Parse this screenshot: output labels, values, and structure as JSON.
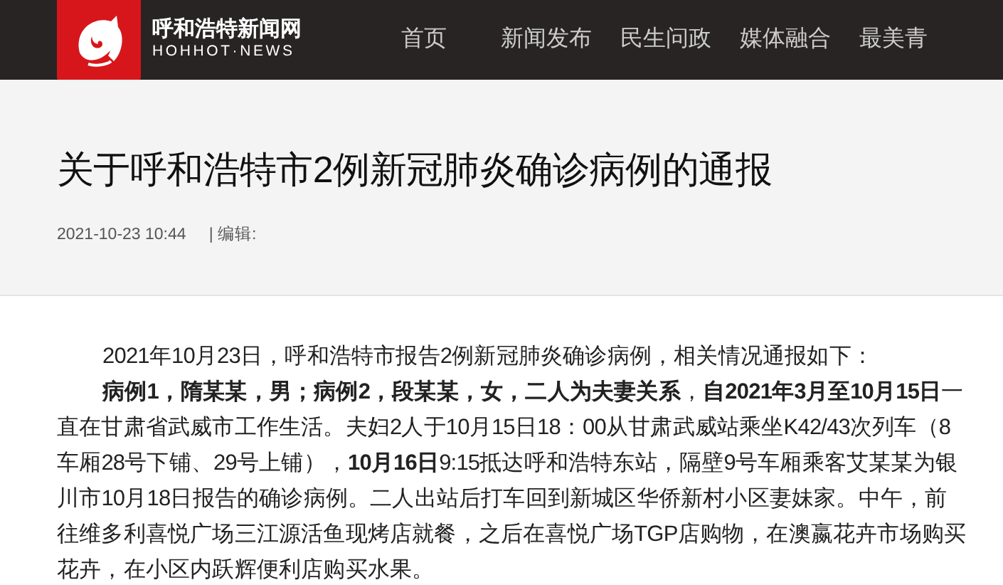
{
  "site": {
    "name": "呼和浩特新闻网",
    "subtitle": "HOHHOT·NEWS"
  },
  "nav": [
    {
      "label": "首页",
      "selected": false
    },
    {
      "label": "新闻发布",
      "selected": false
    },
    {
      "label": "民生问政",
      "selected": false
    },
    {
      "label": "媒体融合",
      "selected": false
    },
    {
      "label": "最美青",
      "selected": false
    }
  ],
  "article": {
    "title": "关于呼和浩特市2例新冠肺炎确诊病例的通报",
    "date": "2021-10-23 10:44",
    "editor": "| 编辑:",
    "paragraphs": [
      "2021年10月23日，呼和浩特市报告2例新冠肺炎确诊病例，相关情况通报如下：",
      "**病例1，隋某某，男；病例2，段某某，女，二人为夫妻关系**，**自2021年3月至10月15日**一直在甘肃省武威市工作生活。夫妇2人于10月15日18：00从甘肃武威站乘坐K42/43次列车（8车厢28号下铺、29号上铺），**10月16日**9:15抵达呼和浩特东站，隔壁9号车厢乘客艾某某为银川市10月18日报告的确诊病例。二人出站后打车回到新城区华侨新村小区妻妹家。中午，前往维多利喜悦广场三江源活鱼现烤店就餐，之后在喜悦广场TGP店购物，在澳嬴花卉市场购买花卉，在小区内跃辉便利店购买水果。"
    ]
  }
}
